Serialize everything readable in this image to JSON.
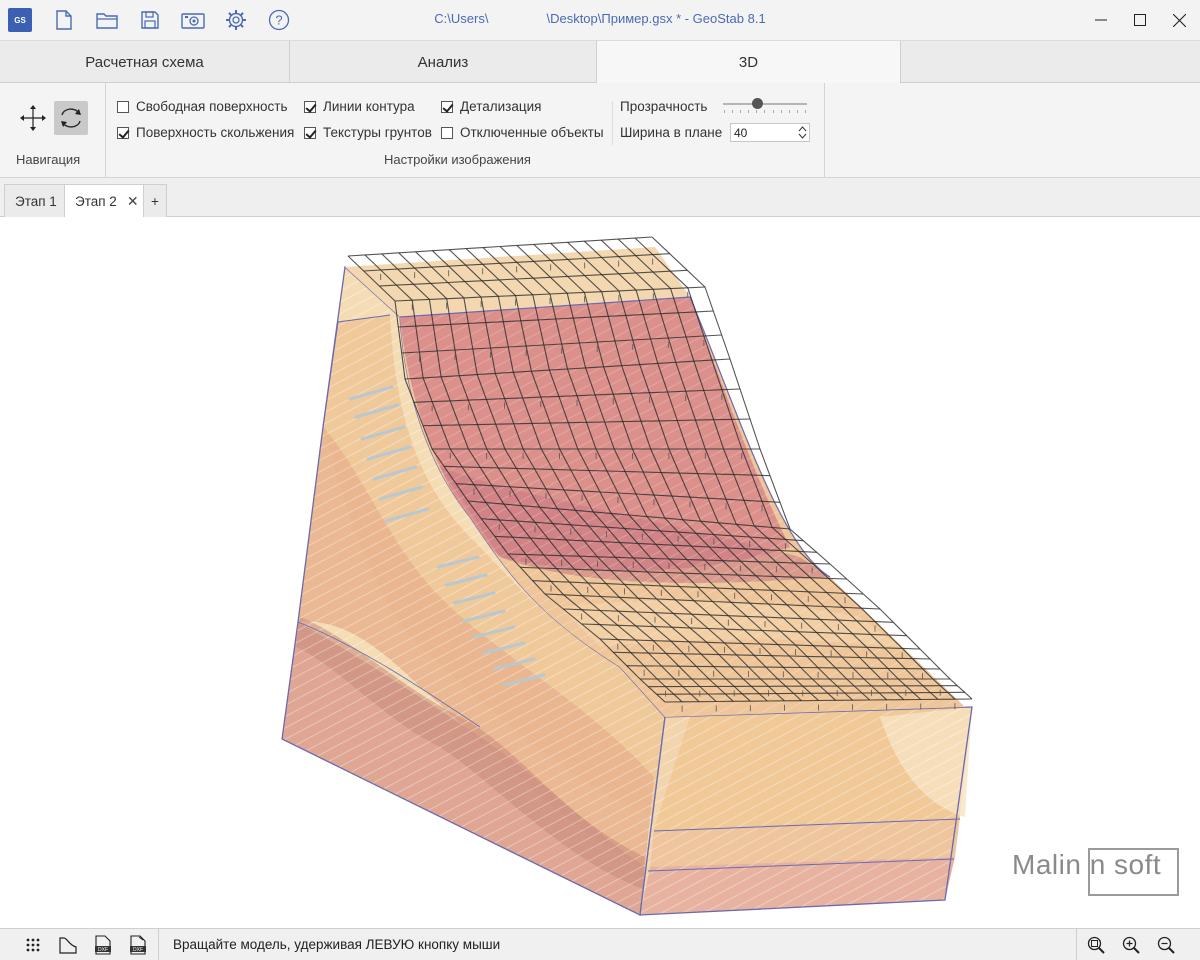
{
  "app": {
    "logo_text": "GS",
    "title_path_start": "C:\\Users\\",
    "title_path_end": "\\Desktop\\Пример.gsx * - GeoStab 8.1"
  },
  "toolbar_icons": [
    "new-file-icon",
    "open-folder-icon",
    "save-icon",
    "camera-icon",
    "settings-gear-icon",
    "help-icon"
  ],
  "main_tabs": [
    {
      "label": "Расчетная схема",
      "active": false
    },
    {
      "label": "Анализ",
      "active": false
    },
    {
      "label": "3D",
      "active": true
    }
  ],
  "ribbon": {
    "navigation": {
      "label": "Навигация",
      "tools": [
        {
          "icon": "pan-arrows-icon",
          "active": false
        },
        {
          "icon": "rotate-icon",
          "active": true
        }
      ]
    },
    "image_settings": {
      "label": "Настройки изображения",
      "checkboxes": [
        {
          "label": "Свободная поверхность",
          "checked": false
        },
        {
          "label": "Поверхность скольжения",
          "checked": true
        },
        {
          "label": "Линии контура",
          "checked": true
        },
        {
          "label": "Текстуры грунтов",
          "checked": true
        },
        {
          "label": "Детализация",
          "checked": true
        },
        {
          "label": "Отключенные объекты",
          "checked": false
        }
      ],
      "transparency_label": "Прозрачность",
      "transparency_level": 0.4,
      "width_label": "Ширина в плане",
      "width_value": "40"
    }
  },
  "stage_tabs": [
    {
      "label": "Этап 1",
      "active": false
    },
    {
      "label": "Этап 2",
      "active": true
    }
  ],
  "add_stage_label": "+",
  "close_label": "✕",
  "viewport": {
    "watermark": "Malin n soft"
  },
  "status": {
    "left_icons": [
      "grid-dots-icon",
      "slope-profile-icon",
      "dxf-export-icon",
      "dxf-import-icon"
    ],
    "message": "Вращайте модель, удерживая ЛЕВУЮ кнопку мыши",
    "right_icons": [
      "zoom-fit-icon",
      "zoom-in-icon",
      "zoom-out-icon"
    ]
  },
  "colors": {
    "accent": "#4a6bb3",
    "soil_light": "#f1d7ae",
    "soil_pink": "#e2a99a",
    "soil_orange": "#efc08a",
    "slip_surface": "#d27f7f",
    "mesh": "#2a2a2a",
    "outline": "#6a6ab0"
  }
}
